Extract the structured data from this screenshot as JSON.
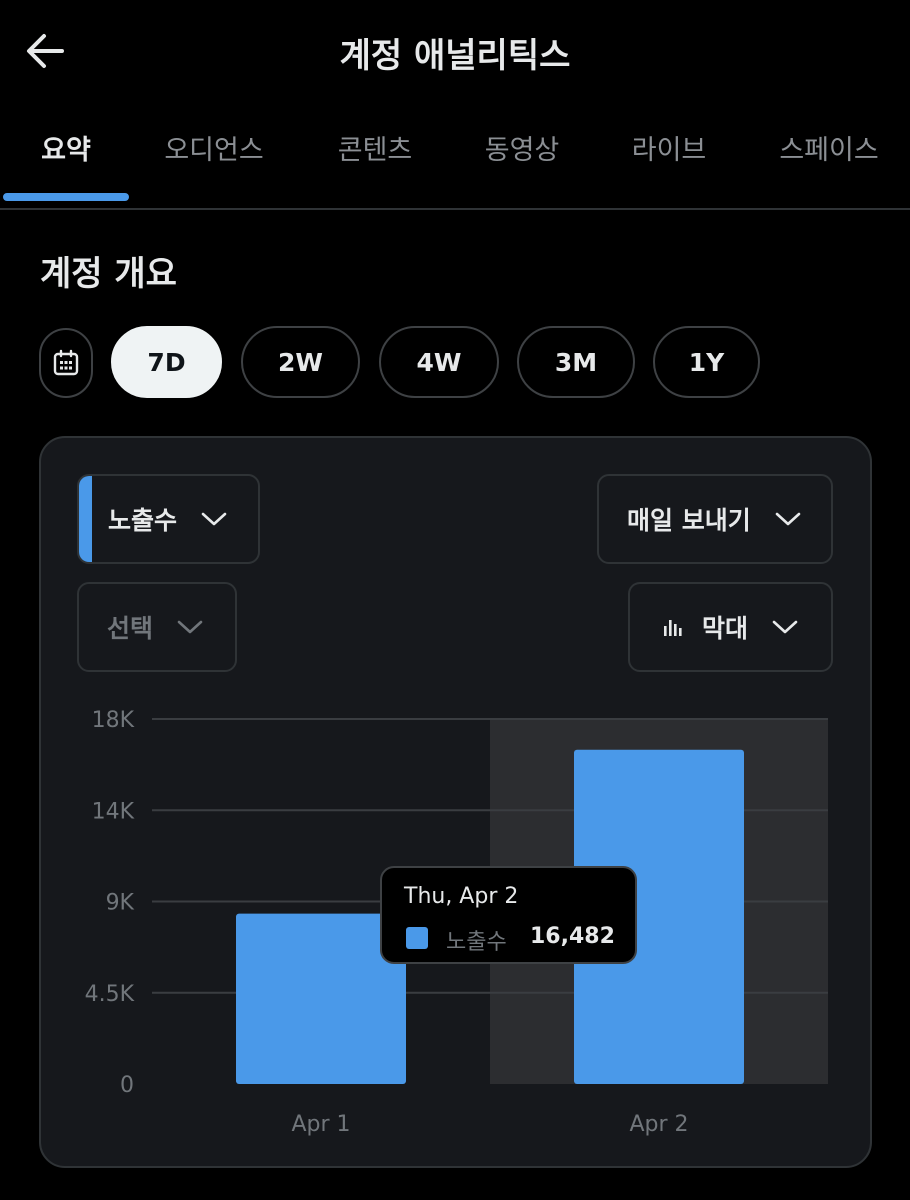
{
  "header": {
    "title": "계정 애널리틱스"
  },
  "tabs": [
    {
      "label": "요약",
      "active": true
    },
    {
      "label": "오디언스"
    },
    {
      "label": "콘텐츠"
    },
    {
      "label": "동영상"
    },
    {
      "label": "라이브"
    },
    {
      "label": "스페이스"
    }
  ],
  "overview": {
    "title": "계정 개요",
    "ranges": [
      {
        "label": "7D",
        "active": true
      },
      {
        "label": "2W"
      },
      {
        "label": "4W"
      },
      {
        "label": "3M"
      },
      {
        "label": "1Y"
      }
    ]
  },
  "controls": {
    "metric_label": "노출수",
    "frequency_label": "매일 보내기",
    "compare_label": "선택",
    "chart_type_label": "막대"
  },
  "colors": {
    "accent": "#4a99e9",
    "highlight_band": "#2c2d30"
  },
  "chart_data": {
    "type": "bar",
    "categories": [
      "Apr 1",
      "Apr 2"
    ],
    "series": [
      {
        "name": "노출수",
        "values": [
          8400,
          16482
        ]
      }
    ],
    "ylim": [
      0,
      18000
    ],
    "yticks": [
      "0",
      "4.5K",
      "9K",
      "14K",
      "18K"
    ],
    "highlighted_category": "Apr 2",
    "grid": true
  },
  "tooltip": {
    "date": "Thu, Apr 2",
    "series_name": "노출수",
    "value": "16,482"
  }
}
